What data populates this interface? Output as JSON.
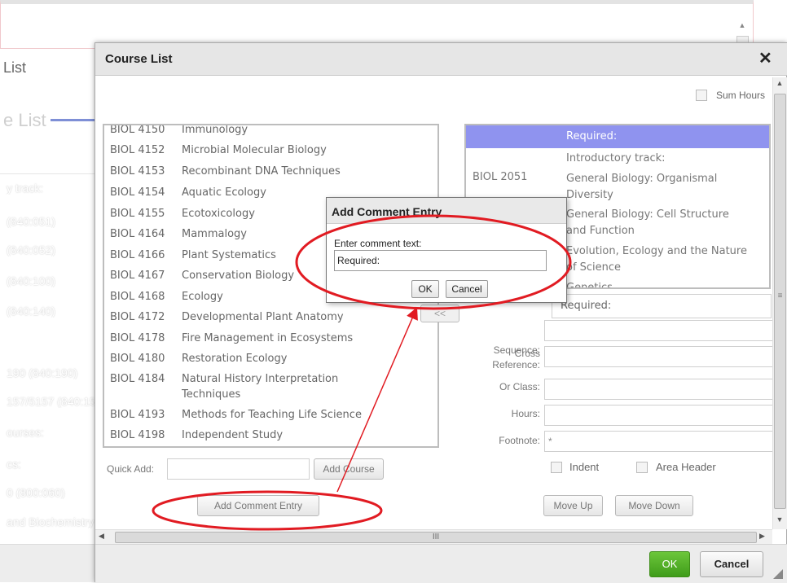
{
  "background": {
    "list_title": "List",
    "section_title": "e List",
    "items": [
      "y track:",
      "(840:051)",
      "(840:052)",
      "(840:100)",
      "(840:140)",
      "190 (840:190)",
      "157/5157 (840:157)",
      "ourses:",
      "cs:",
      "0 (800:060)",
      "and Biochemistry"
    ]
  },
  "dialog": {
    "title": "Course List",
    "close_icon": "close-icon",
    "sum_hours_label": "Sum Hours",
    "courses": [
      {
        "code": "BIOL 4150",
        "title": "Immunology"
      },
      {
        "code": "BIOL 4152",
        "title": "Microbial Molecular Biology"
      },
      {
        "code": "BIOL 4153",
        "title": "Recombinant DNA Techniques"
      },
      {
        "code": "BIOL 4154",
        "title": "Aquatic Ecology"
      },
      {
        "code": "BIOL 4155",
        "title": "Ecotoxicology"
      },
      {
        "code": "BIOL 4164",
        "title": "Mammalogy"
      },
      {
        "code": "BIOL 4166",
        "title": "Plant Systematics"
      },
      {
        "code": "BIOL 4167",
        "title": "Conservation Biology"
      },
      {
        "code": "BIOL 4168",
        "title": "Ecology"
      },
      {
        "code": "BIOL 4172",
        "title": "Developmental Plant Anatomy"
      },
      {
        "code": "BIOL 4178",
        "title": "Fire Management in Ecosystems"
      },
      {
        "code": "BIOL 4180",
        "title": "Restoration Ecology"
      },
      {
        "code": "BIOL 4184",
        "title": "Natural History Interpretation",
        "title2": "Techniques"
      },
      {
        "code": "BIOL 4193",
        "title": "Methods for Teaching Life Science"
      },
      {
        "code": "BIOL 4198",
        "title": "Independent Study"
      }
    ],
    "move_button": "<<",
    "selected": [
      {
        "code": "",
        "title": "Required:"
      },
      {
        "code": "",
        "title": "Introductory track:"
      },
      {
        "code": "BIOL 2051",
        "title": "General Biology: Organismal",
        "title2": "Diversity"
      },
      {
        "code": "",
        "title": "General Biology: Cell Structure",
        "title2": "and Function"
      },
      {
        "code": "",
        "title": "Evolution, Ecology and the Nature",
        "title2": "of Science"
      },
      {
        "code": "",
        "title": "Genetics"
      }
    ],
    "form": {
      "required_value": "Required:",
      "sequence_label": "Sequence:",
      "cross_ref_label_1": "Cross",
      "cross_ref_label_2": "Reference:",
      "or_class_label": "Or Class:",
      "hours_label": "Hours:",
      "footnote_label": "Footnote:",
      "footnote_value": "*",
      "indent_label": "Indent",
      "area_header_label": "Area Header"
    },
    "quick_add_label": "Quick Add:",
    "add_course_button": "Add Course",
    "add_comment_button": "Add Comment Entry",
    "move_up_button": "Move Up",
    "move_down_button": "Move Down",
    "h_scroll_grip": "III",
    "v_scroll_grip": "≡",
    "ok_button": "OK",
    "cancel_button": "Cancel",
    "accent_color": "#8f93ef",
    "ok_color": "#4ea524"
  },
  "popup": {
    "title": "Add Comment Entry",
    "prompt": "Enter comment text:",
    "input_value": "Required:",
    "ok_button": "OK",
    "cancel_button": "Cancel"
  },
  "annotation_color": "#e11b22"
}
